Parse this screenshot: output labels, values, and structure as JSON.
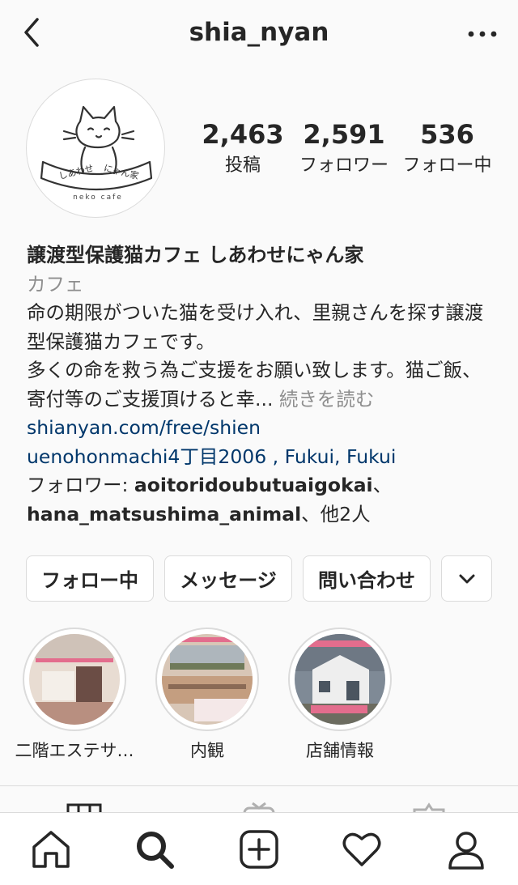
{
  "header": {
    "username": "shia_nyan"
  },
  "stats": {
    "posts_count": "2,463",
    "posts_label": "投稿",
    "followers_count": "2,591",
    "followers_label": "フォロワー",
    "following_count": "536",
    "following_label": "フォロー中"
  },
  "avatar": {
    "logo_text_left": "しあわせ",
    "logo_text_right": "にゃん家",
    "logo_subtext": "neko cafe"
  },
  "bio": {
    "name": "譲渡型保護猫カフェ しあわせにゃん家",
    "category": "カフェ",
    "line1": "命の期限がついた猫を受け入れ、里親さんを探す譲渡型保護猫カフェです。",
    "line2": "多くの命を救う為ご支援をお願い致します。猫ご飯、寄付等のご支援頂けると幸...",
    "more": "続きを読む",
    "website": "shianyan.com/free/shien",
    "address": "uenohonmachi4丁目2006 , Fukui, Fukui",
    "followed_by_prefix": "フォロワー: ",
    "followed_by_1": "aoitoridoubutuaigokai",
    "sep": "、",
    "followed_by_2": "hana_matsushima_animal",
    "followed_by_suffix": "、他2人"
  },
  "buttons": {
    "following": "フォロー中",
    "message": "メッセージ",
    "contact": "問い合わせ"
  },
  "highlights": [
    {
      "label": "二階エステサ…"
    },
    {
      "label": "内観"
    },
    {
      "label": "店舗情報"
    }
  ],
  "bottom_nav": [
    "home-icon",
    "search-icon",
    "new-post-icon",
    "activity-heart-icon",
    "profile-icon"
  ],
  "colors": {
    "link": "#00376b",
    "secondary": "#8e8e8e",
    "border": "#dbdbdb"
  }
}
